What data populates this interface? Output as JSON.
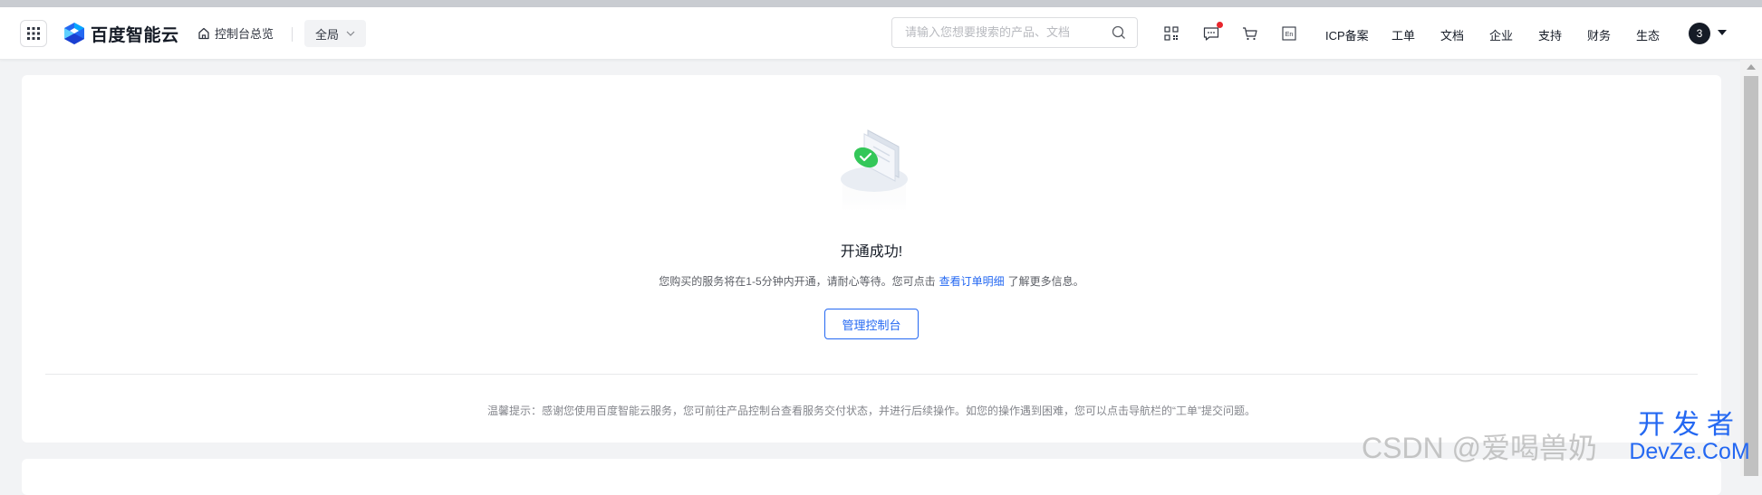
{
  "header": {
    "brand": "百度智能云",
    "overview_label": "控制台总览",
    "region_label": "全局",
    "search_placeholder": "请输入您想要搜索的产品、文档",
    "nav_items": [
      "ICP备案",
      "工单",
      "文档",
      "企业",
      "支持",
      "财务",
      "生态"
    ],
    "avatar_text": "3"
  },
  "main": {
    "success_title": "开通成功!",
    "desc_prefix": "您购买的服务将在1-5分钟内开通，请耐心等待。您可点击",
    "desc_link": "查看订单明细",
    "desc_suffix": "了解更多信息。",
    "manage_button": "管理控制台",
    "tip": "温馨提示：感谢您使用百度智能云服务，您可前往产品控制台查看服务交付状态，并进行后续操作。如您的操作遇到困难，您可以点击导航栏的“工单”提交问题。"
  },
  "watermark": {
    "text": "CSDN @爱喝兽奶",
    "logo_top": "开发者",
    "logo_bottom": "DevZe.CoM"
  },
  "colors": {
    "accent": "#2468f2",
    "success": "#34c759",
    "notification": "#e8262d"
  },
  "icons": [
    "apps-grid-icon",
    "baidu-cloud-logo-icon",
    "home-icon",
    "chevron-down-icon",
    "search-icon",
    "qrcode-icon",
    "message-icon",
    "cart-icon",
    "language-en-icon",
    "caret-down-icon",
    "success-illustration"
  ]
}
